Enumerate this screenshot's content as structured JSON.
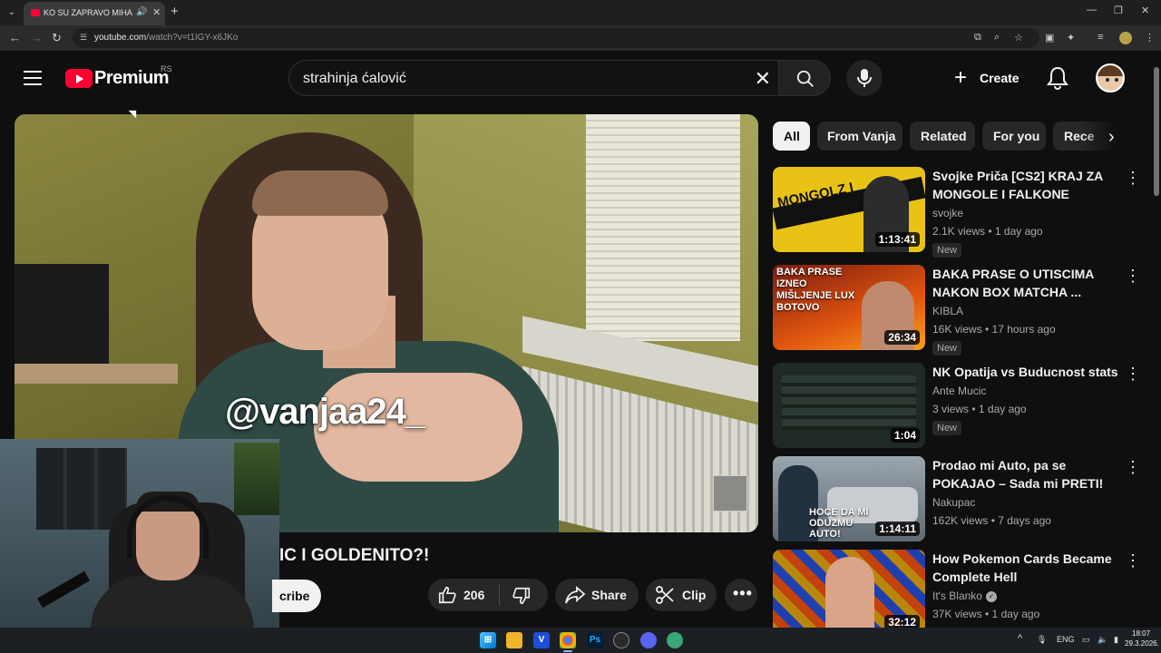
{
  "browser": {
    "tab_title": "KO SU ZAPRAVO MIHAJLO",
    "url_host": "youtube.com",
    "url_path": "/watch?v=t1IGY-x6JKo",
    "new_tab": "+",
    "minimize": "—",
    "restore": "❐",
    "close": "✕"
  },
  "header": {
    "brand": "Premium",
    "country": "RS",
    "search_value": "strahinja ćalović",
    "create_label": "Create"
  },
  "player": {
    "overlay_text": "@vanjaa24_"
  },
  "video": {
    "title_visible": "IC I GOLDENITO?!",
    "subscribe_label": "cribe",
    "like_count": "206",
    "share_label": "Share",
    "clip_label": "Clip"
  },
  "chips": [
    "All",
    "From Vanja",
    "Related",
    "For you",
    "Rece"
  ],
  "recommendations": [
    {
      "title": "Svojke Priča [CS2] KRAJ ZA MONGOLE I FALKONE",
      "channel": "svojke",
      "meta": "2.1K views • 1 day ago",
      "badge": "New",
      "duration": "1:13:41",
      "thumb_text": "MONGOLZ I FALCONS OUT",
      "thumb_color": "#e8c315"
    },
    {
      "title": "BAKA PRASE O UTISCIMA NAKON BOX MATCHA ...",
      "channel": "KIBLA",
      "meta": "16K views • 17 hours ago",
      "badge": "New",
      "duration": "26:34",
      "thumb_text": "BAKA PRASE IZNEO MIŠLJENJE LUX BOTOVO",
      "thumb_color": "#c2410c"
    },
    {
      "title": "NK Opatija vs Buducnost   stats",
      "channel": "Ante Mucic",
      "meta": "3 views • 1 day ago",
      "badge": "New",
      "duration": "1:04",
      "thumb_text": "",
      "thumb_color": "#1f2a24"
    },
    {
      "title": "Prodao mi Auto, pa se POKAJAO – Sada mi PRETI!",
      "channel": "Nakupac",
      "meta": "162K views • 7 days ago",
      "badge": "",
      "duration": "1:14:11",
      "thumb_text": "HOĆE DA MI ODUZMU AUTO!",
      "thumb_color": "#7d8790"
    },
    {
      "title": "How Pokemon Cards Became Complete Hell",
      "channel": "It's Blanko",
      "meta": "37K views • 1 day ago",
      "badge": "",
      "duration": "32:12",
      "thumb_text": "",
      "thumb_color": "#b8860b"
    }
  ],
  "taskbar": {
    "lang": "ENG",
    "time": "18:07",
    "date": "29.3.2026."
  }
}
